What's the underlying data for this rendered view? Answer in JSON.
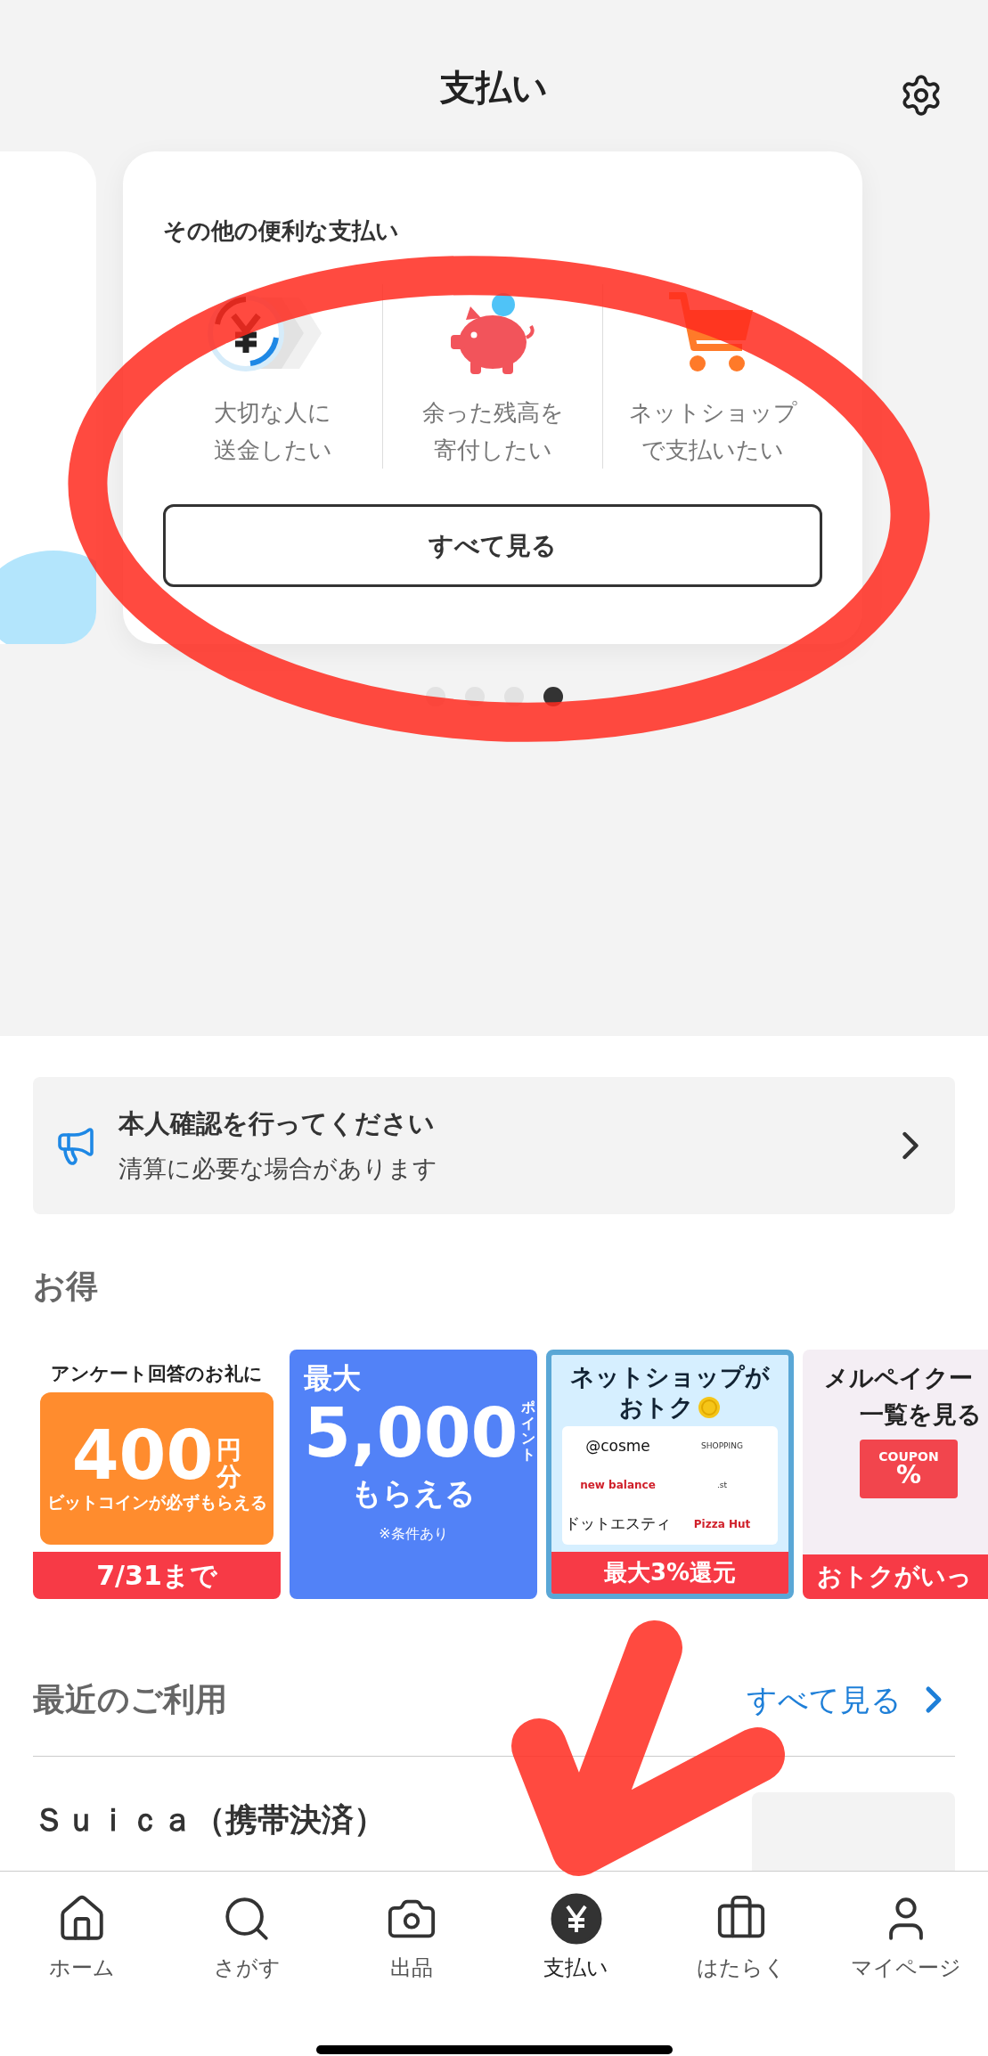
{
  "header": {
    "title": "支払い"
  },
  "carousel": {
    "card": {
      "title": "その他の便利な支払い",
      "actions": [
        {
          "kind": "send",
          "lines": [
            "大切な人に",
            "送金したい"
          ]
        },
        {
          "kind": "donate",
          "lines": [
            "余った残高を",
            "寄付したい"
          ]
        },
        {
          "kind": "shop",
          "lines": [
            "ネットショップ",
            "で支払いたい"
          ]
        }
      ],
      "button": "すべて見る"
    },
    "annotation": {
      "kind": "ellipse"
    },
    "dots": [
      {
        "selected": false
      },
      {
        "selected": false
      },
      {
        "selected": false
      },
      {
        "selected": true
      }
    ]
  },
  "notice": {
    "title": "本人確認を行ってください",
    "subtitle": "清算に必要な場合があります"
  },
  "deals": {
    "title": "お得",
    "banners": [
      {
        "kind": "survey",
        "top": "アンケート回答のお礼に",
        "amount": "400",
        "unit": "円分",
        "note": "ビットコインが必ずもらえる",
        "footer": "7/31まで"
      },
      {
        "kind": "points",
        "top": "最大",
        "amount": "5,000",
        "unit": "ポイント",
        "note": "もらえる",
        "footer": "※条件あり"
      },
      {
        "kind": "shops",
        "top": "ネットショップが",
        "amount": "おトク",
        "logos": [
          "@cosme",
          "SHOPPING",
          "new balance",
          ".st",
          "ドットエスティ",
          "Pizza Hut"
        ],
        "footer": "最大3%還元"
      },
      {
        "kind": "coupon",
        "top": "メルペイクー",
        "amount": "一覧を見る",
        "unit": "COUPON",
        "note": "%",
        "footer": "おトクがいっ"
      }
    ]
  },
  "recent": {
    "title": "最近のご利用",
    "link": "すべて見る",
    "rows": [
      {
        "name": "Ｓｕｉｃａ（携帯決済）"
      }
    ],
    "annotation": {
      "kind": "checkmark"
    }
  },
  "nav": [
    {
      "kind": "home",
      "label": "ホーム",
      "selected": false
    },
    {
      "kind": "search",
      "label": "さがす",
      "selected": false
    },
    {
      "kind": "camera",
      "label": "出品",
      "selected": false
    },
    {
      "kind": "pay",
      "label": "支払い",
      "selected": true
    },
    {
      "kind": "work",
      "label": "はたらく",
      "selected": false
    },
    {
      "kind": "user",
      "label": "マイページ",
      "selected": false
    }
  ]
}
